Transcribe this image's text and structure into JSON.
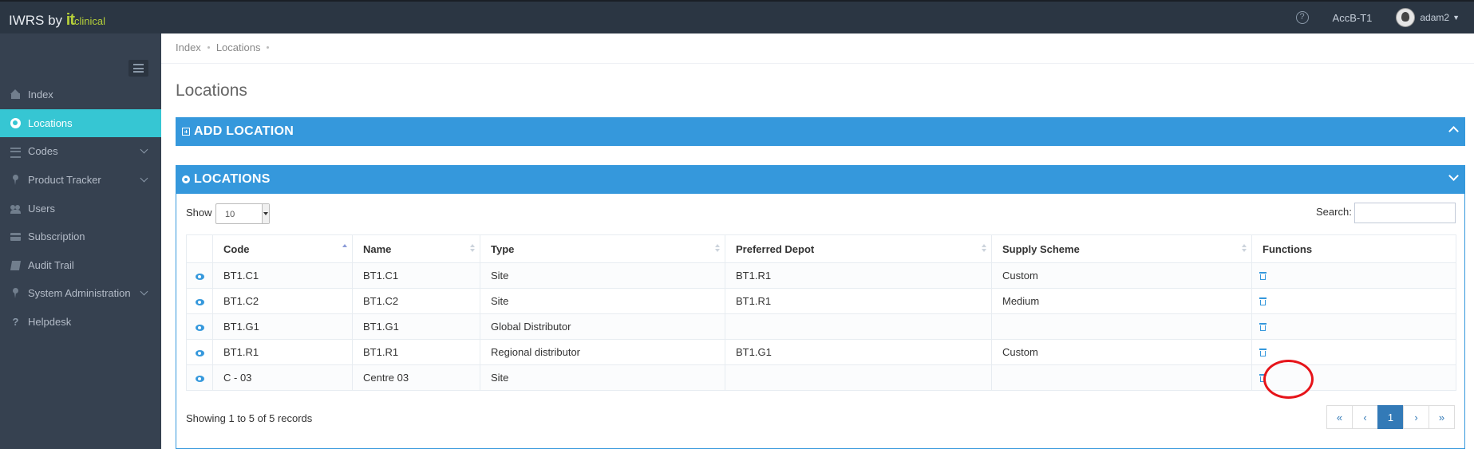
{
  "topbar": {
    "brand_prefix": "IWRS by ",
    "brand_it": "it",
    "brand_clinical": "clinical",
    "help_icon": "question-circle-icon",
    "study": "AccB-T1",
    "username": "adam2"
  },
  "sidebar": {
    "items": [
      {
        "label": "Index",
        "icon": "home-icon"
      },
      {
        "label": "Locations",
        "icon": "globe-icon",
        "active": true
      },
      {
        "label": "Codes",
        "icon": "list-icon",
        "submenu": true
      },
      {
        "label": "Product Tracker",
        "icon": "map-pin-icon",
        "submenu": true
      },
      {
        "label": "Users",
        "icon": "users-icon"
      },
      {
        "label": "Subscription",
        "icon": "credit-card-icon"
      },
      {
        "label": "Audit Trail",
        "icon": "book-icon"
      },
      {
        "label": "System Administration",
        "icon": "map-pin-icon",
        "submenu": true
      },
      {
        "label": "Helpdesk",
        "icon": "question-icon"
      }
    ]
  },
  "breadcrumb": [
    "Index",
    "Locations"
  ],
  "page_title": "Locations",
  "add_panel": {
    "title": "ADD LOCATION"
  },
  "list_panel": {
    "title": "LOCATIONS"
  },
  "table_controls": {
    "show_label": "Show",
    "page_size": "10",
    "search_label": "Search:",
    "search_value": ""
  },
  "table": {
    "columns": [
      "Code",
      "Name",
      "Type",
      "Preferred Depot",
      "Supply Scheme",
      "Functions"
    ],
    "rows": [
      {
        "code": "BT1.C1",
        "name": "BT1.C1",
        "type": "Site",
        "depot": "BT1.R1",
        "scheme": "Custom"
      },
      {
        "code": "BT1.C2",
        "name": "BT1.C2",
        "type": "Site",
        "depot": "BT1.R1",
        "scheme": "Medium"
      },
      {
        "code": "BT1.G1",
        "name": "BT1.G1",
        "type": "Global Distributor",
        "depot": "",
        "scheme": ""
      },
      {
        "code": "BT1.R1",
        "name": "BT1.R1",
        "type": "Regional distributor",
        "depot": "BT1.G1",
        "scheme": "Custom"
      },
      {
        "code": "C - 03",
        "name": "Centre 03",
        "type": "Site",
        "depot": "",
        "scheme": ""
      }
    ]
  },
  "footer": {
    "showing": "Showing 1 to 5 of 5 records",
    "pager": [
      "«",
      "‹",
      "1",
      "›",
      "»"
    ],
    "current_page": "1"
  },
  "colors": {
    "topbar": "#2b3643",
    "sidebar": "#364150",
    "active_item": "#36c6d3",
    "panel": "#3598dc",
    "highlight": "#e6141a"
  }
}
